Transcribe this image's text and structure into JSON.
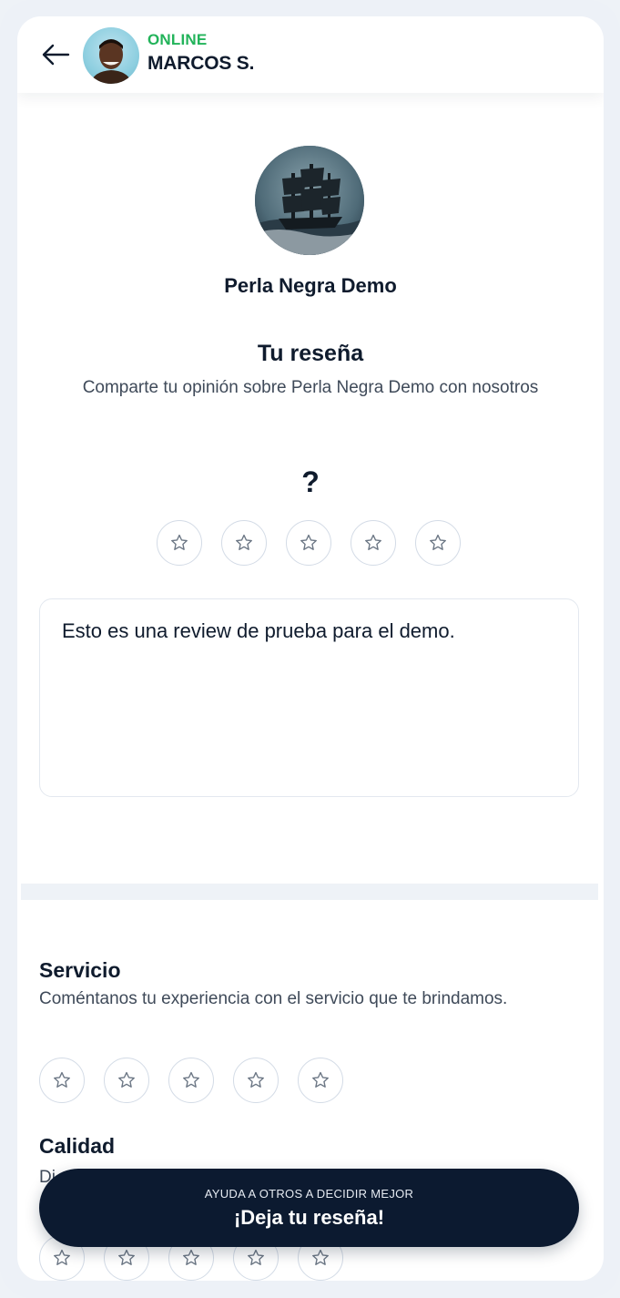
{
  "header": {
    "status": "ONLINE",
    "user_name": "MARCOS S."
  },
  "business": {
    "name": "Perla Negra Demo"
  },
  "review": {
    "title": "Tu reseña",
    "subtitle": "Comparte tu opinión sobre Perla Negra Demo con nosotros",
    "rating_display": "?",
    "rating": 0,
    "max_rating": 5,
    "text": "Esto es una review de prueba para el demo."
  },
  "categories": [
    {
      "title": "Servicio",
      "description": "Coméntanos tu experiencia con el servicio que te brindamos.",
      "rating": 0
    },
    {
      "title": "Calidad",
      "description": "Di",
      "rating": 0
    }
  ],
  "cta": {
    "subtitle": "AYUDA A OTROS A DECIDIR MEJOR",
    "label": "¡Deja tu reseña!"
  },
  "colors": {
    "status_online": "#22b35a",
    "primary_dark": "#0c1a30",
    "star_border": "#d3dbe6"
  },
  "icons": {
    "back": "arrow-left-icon",
    "star": "star-outline-icon"
  }
}
